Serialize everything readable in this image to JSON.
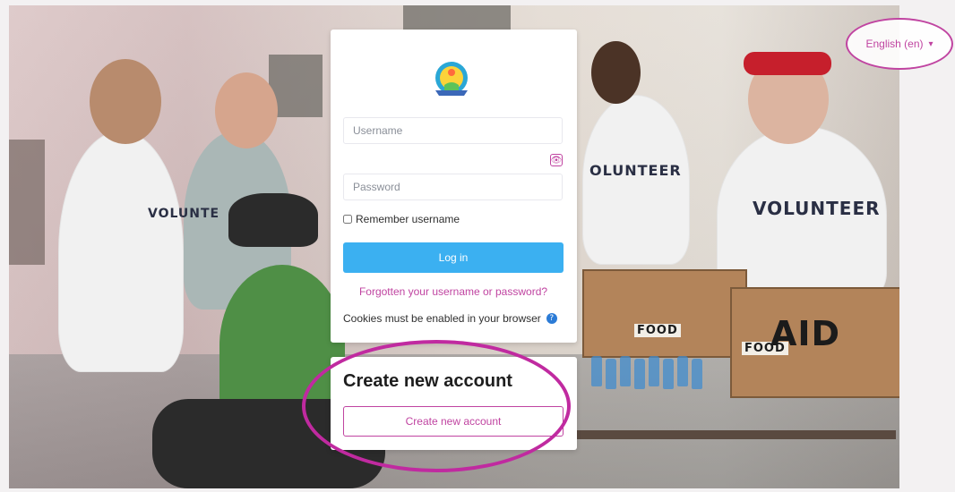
{
  "language": {
    "label": "English (en)"
  },
  "login": {
    "username_placeholder": "Username",
    "password_placeholder": "Password",
    "remember_label": "Remember username",
    "login_button": "Log in",
    "forgot_link": "Forgotten your username or password?",
    "cookies_text": "Cookies must be enabled in your browser"
  },
  "create_account": {
    "title": "Create new account",
    "button": "Create new account"
  },
  "photo_text": {
    "volunteer_right": "VOLUNTEER",
    "volunteer_middle": "OLUNTEER",
    "volunteer_left": "VOLUNTE",
    "food_box_1": "FOOD",
    "food_box_2": "FOOD",
    "aid": "AID"
  },
  "colors": {
    "accent": "#c044a1",
    "login_button_bg": "#3bb0f1",
    "highlight_ring": "#c02aa0"
  }
}
